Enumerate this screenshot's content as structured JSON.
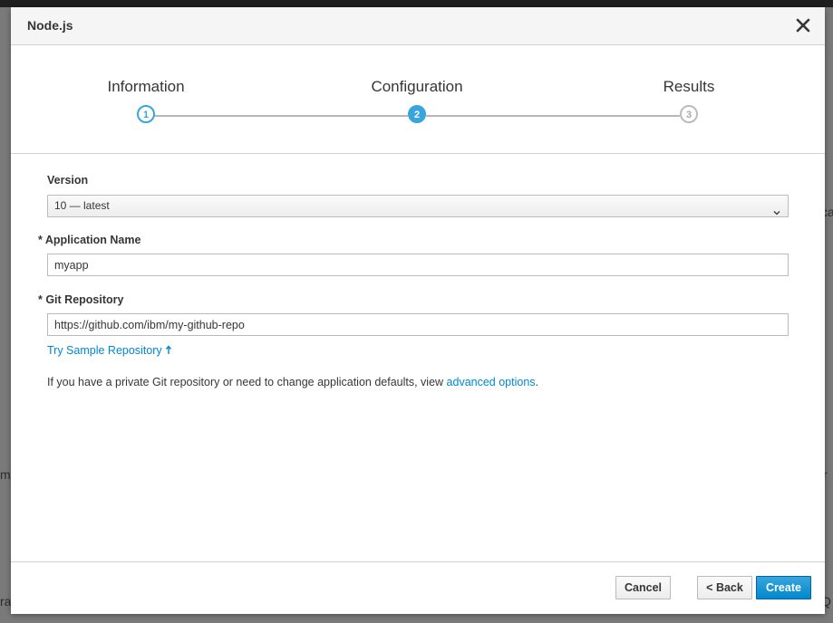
{
  "background_fragments": [
    "ca",
    "m",
    "Q",
    "ra",
    "r"
  ],
  "modal": {
    "title": "Node.js",
    "close_icon": "close-icon"
  },
  "wizard": {
    "steps": [
      {
        "label": "Information",
        "number": "1",
        "state": "completed"
      },
      {
        "label": "Configuration",
        "number": "2",
        "state": "active"
      },
      {
        "label": "Results",
        "number": "3",
        "state": "upcoming"
      }
    ]
  },
  "form": {
    "version": {
      "label": "Version",
      "value": "10 — latest"
    },
    "app_name": {
      "label": "* Application Name",
      "value": "myapp"
    },
    "git_repo": {
      "label": "* Git Repository",
      "value": "https://github.com/ibm/my-github-repo"
    },
    "sample_link": "Try Sample Repository",
    "sample_link_icon": "arrow-up-icon",
    "help": {
      "prefix": "If you have a private Git repository or need to change application defaults, view ",
      "link": "advanced options",
      "suffix": "."
    }
  },
  "footer": {
    "cancel_label": "Cancel",
    "back_label": "< Back",
    "create_label": "Create"
  },
  "colors": {
    "accent": "#39a5dc",
    "link": "#0088ce",
    "primary_button": "#0088ce"
  }
}
